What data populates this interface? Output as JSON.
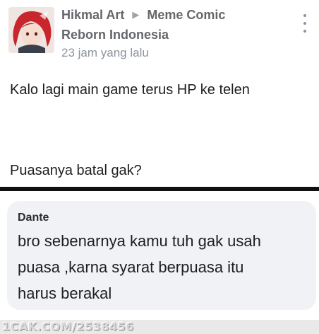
{
  "post": {
    "author": "Hikmal Art",
    "group_line1": "Meme Comic",
    "group_line2": "Reborn Indonesia",
    "time": "23 jam yang lalu",
    "line1": "Kalo lagi main game terus HP ke telen",
    "line2": "Puasanya batal gak?"
  },
  "comment": {
    "author": "Dante",
    "line1": "bro sebenarnya kamu tuh gak usah",
    "line2": "puasa ,karna syarat berpuasa itu",
    "line3": "harus berakal"
  },
  "watermark": "1CAK.COM/2538456",
  "icons": {
    "arrow": "triangle-right-icon",
    "menu": "more-options-icon",
    "avatar": "avatar"
  },
  "colors": {
    "name_gray": "#64676b",
    "bubble": "#f0f2f5",
    "divider": "#111111"
  }
}
